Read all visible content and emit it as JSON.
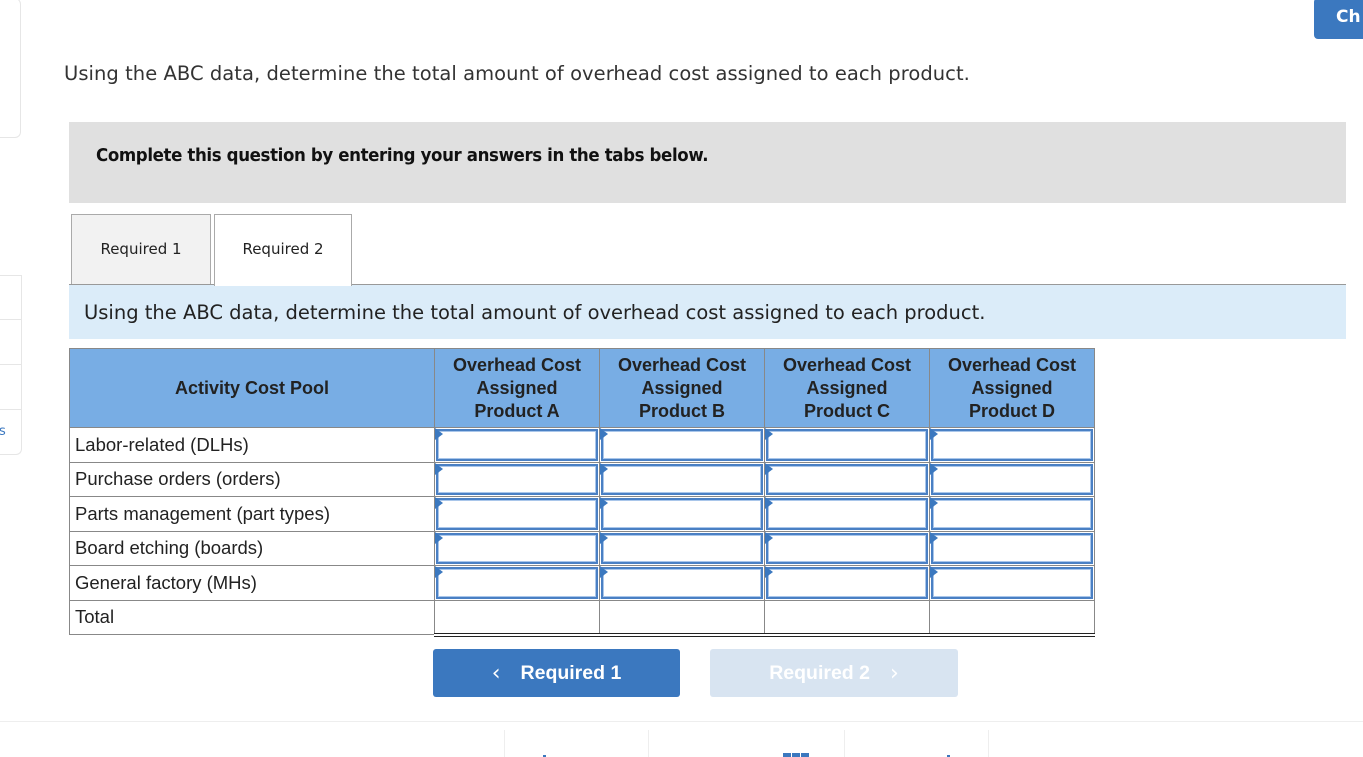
{
  "header": {
    "check_button_label": "Ch"
  },
  "left_panel": {
    "items": [
      "",
      "",
      "",
      "s"
    ]
  },
  "question_text": "Using the ABC data, determine the total amount of overhead cost assigned to each product.",
  "instructions": "Complete this question by entering your answers in the tabs below.",
  "tabs": [
    {
      "label": "Required 1",
      "active": false
    },
    {
      "label": "Required 2",
      "active": true
    }
  ],
  "sub_question": "Using the ABC data, determine the total amount of overhead cost assigned to each product.",
  "table": {
    "headers": {
      "pool": "Activity Cost Pool",
      "products": [
        {
          "line1": "Overhead Cost",
          "line2": "Assigned",
          "line3": "Product A"
        },
        {
          "line1": "Overhead Cost",
          "line2": "Assigned",
          "line3": "Product B"
        },
        {
          "line1": "Overhead Cost",
          "line2": "Assigned",
          "line3": "Product C"
        },
        {
          "line1": "Overhead Cost",
          "line2": "Assigned",
          "line3": "Product D"
        }
      ]
    },
    "rows": [
      {
        "label": "Labor-related (DLHs)",
        "values": [
          "",
          "",
          "",
          ""
        ]
      },
      {
        "label": "Purchase orders (orders)",
        "values": [
          "",
          "",
          "",
          ""
        ]
      },
      {
        "label": "Parts management (part types)",
        "values": [
          "",
          "",
          "",
          ""
        ]
      },
      {
        "label": "Board etching (boards)",
        "values": [
          "",
          "",
          "",
          ""
        ]
      },
      {
        "label": "General factory (MHs)",
        "values": [
          "",
          "",
          "",
          ""
        ]
      }
    ],
    "total": {
      "label": "Total",
      "values": [
        "",
        "",
        "",
        ""
      ]
    }
  },
  "navigation": {
    "prev_label": "Required 1",
    "next_label": "Required 2",
    "prev_icon": "‹",
    "next_icon": "›"
  },
  "colors": {
    "accent": "#3b78bf",
    "header_bg": "#78ade4",
    "subquestion_bg": "#dbecf9",
    "instructions_bg": "#e0e0e0",
    "disabled_button": "#d8e4f1"
  }
}
